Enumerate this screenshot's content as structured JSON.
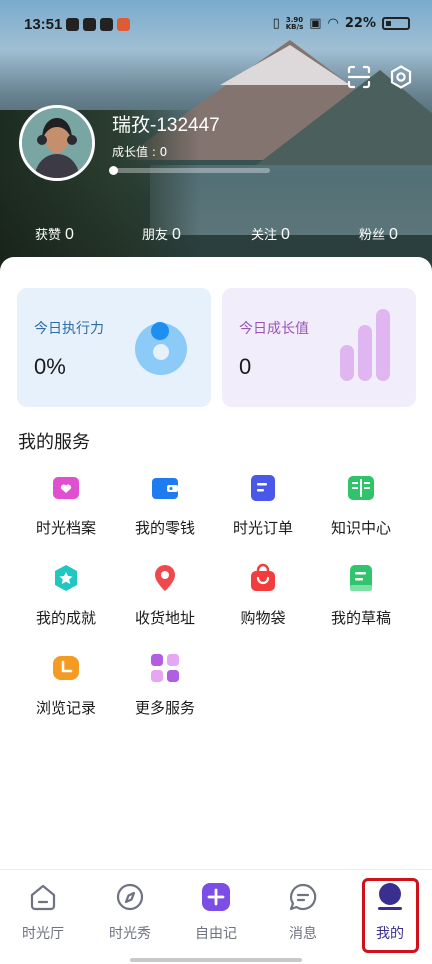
{
  "status_bar": {
    "time": "13:51",
    "net_speed_value": "3.90",
    "net_speed_unit": "KB/s",
    "battery": "22%"
  },
  "profile": {
    "username": "瑞孜-132447",
    "growth_label": "成长值 : 0",
    "growth_progress": 0
  },
  "stats": [
    {
      "label": "获赞",
      "value": "0"
    },
    {
      "label": "朋友",
      "value": "0"
    },
    {
      "label": "关注",
      "value": "0"
    },
    {
      "label": "粉丝",
      "value": "0"
    }
  ],
  "cards": {
    "execution": {
      "title": "今日执行力",
      "value": "0%"
    },
    "growth": {
      "title": "今日成长值",
      "value": "0"
    }
  },
  "services_title": "我的服务",
  "services": [
    {
      "label": "时光档案",
      "icon": "heart-folder-icon",
      "color": "#e04fd0"
    },
    {
      "label": "我的零钱",
      "icon": "wallet-icon",
      "color": "#1e7bf0"
    },
    {
      "label": "时光订单",
      "icon": "order-list-icon",
      "color": "#4b57e8"
    },
    {
      "label": "知识中心",
      "icon": "book-icon",
      "color": "#2fc46a"
    },
    {
      "label": "我的成就",
      "icon": "medal-star-icon",
      "color": "#20c7c0"
    },
    {
      "label": "收货地址",
      "icon": "location-pin-icon",
      "color": "#f0484b"
    },
    {
      "label": "购物袋",
      "icon": "shopping-bag-icon",
      "color": "#f33d3d"
    },
    {
      "label": "我的草稿",
      "icon": "draft-icon",
      "color": "#31c46e"
    },
    {
      "label": "浏览记录",
      "icon": "clock-history-icon",
      "color": "#f59a22"
    },
    {
      "label": "更多服务",
      "icon": "grid-more-icon",
      "color": "#b15fe0"
    }
  ],
  "nav": [
    {
      "label": "时光厅",
      "icon": "home-icon"
    },
    {
      "label": "时光秀",
      "icon": "compass-icon"
    },
    {
      "label": "自由记",
      "icon": "plus-icon"
    },
    {
      "label": "消息",
      "icon": "message-icon"
    },
    {
      "label": "我的",
      "icon": "profile-icon",
      "active": true
    }
  ],
  "colors": {
    "accent": "#3a2f8f",
    "nav_plus": "#7b4fe6",
    "highlight": "#d0111c"
  }
}
